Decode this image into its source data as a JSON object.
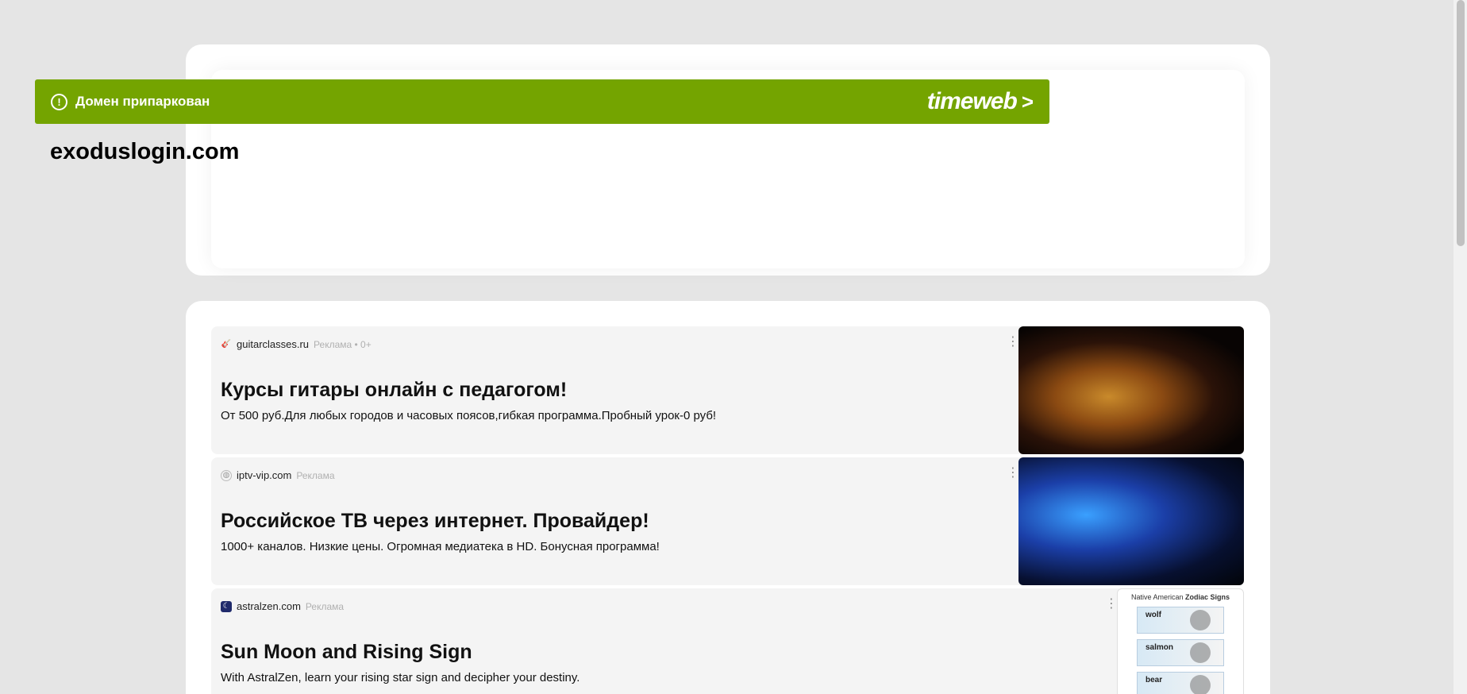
{
  "banner": {
    "status_icon": "exclamation-circle-icon",
    "status_text": "Домен припаркован",
    "brand": "timeweb",
    "brand_arrow": ">"
  },
  "domain": "exoduslogin.com",
  "ads": [
    {
      "site": "guitarclasses.ru",
      "label": "Реклама • 0+",
      "favicon": "guitar-icon",
      "headline": "Курсы гитары онлайн с педагогом!",
      "description": "От 500 руб.Для любых городов и часовых поясов,гибкая программа.Пробный урок-0 руб!",
      "image": "guitar-photo"
    },
    {
      "site": "iptv-vip.com",
      "label": "Реклама",
      "favicon": "globe-icon",
      "headline": "Российское ТВ через интернет. Провайдер!",
      "description": "1000+ каналов. Низкие цены. Огромная медиатека в HD. Бонусная программа!",
      "image": "tv-apps-photo"
    },
    {
      "site": "astralzen.com",
      "label": "Реклама",
      "favicon": "moon-icon",
      "headline": "Sun Moon and Rising Sign",
      "description": "With AstralZen, learn your rising star sign and decipher your destiny.",
      "image": "zodiac-chart"
    }
  ],
  "zodiac_image": {
    "title_plain": "Native American",
    "title_bold": "Zodiac Signs",
    "signs": [
      "wolf",
      "salmon",
      "bear"
    ]
  },
  "colors": {
    "banner": "#74a400",
    "page_bg": "#e5e5e5",
    "ad_bg": "#f4f4f4"
  }
}
